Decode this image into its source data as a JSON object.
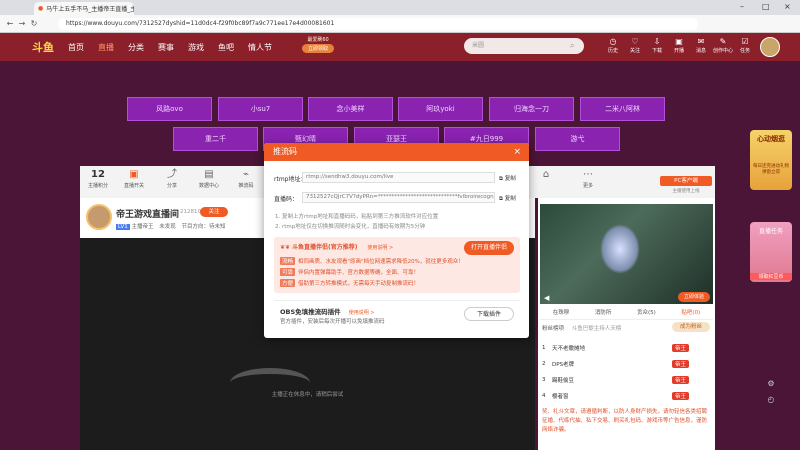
{
  "browser": {
    "tab_title": "马牛上五手不马_主播帝王直播_主",
    "url": "https://www.douyu.com/7312527dyshid=11d0dc4-f29f0bc89f7a9c771ee17e4d00081601"
  },
  "header": {
    "logo": "斗鱼",
    "nav": [
      "首页",
      "直播",
      "分类",
      "赛事",
      "游戏",
      "鱼吧",
      "情人节"
    ],
    "badge_top": "最爱刷60",
    "badge_bottom": "立即领取",
    "search_placeholder": "米圆",
    "icons": [
      {
        "name": "history-icon",
        "label": "历史"
      },
      {
        "name": "follow-icon",
        "label": "关注"
      },
      {
        "name": "download-icon",
        "label": "下载"
      },
      {
        "name": "broadcast-icon",
        "label": "开播"
      },
      {
        "name": "message-icon",
        "label": "消息"
      },
      {
        "name": "creator-icon",
        "label": "创作中心"
      },
      {
        "name": "task-icon",
        "label": "任务"
      }
    ]
  },
  "categories": {
    "row1": [
      "风路ovo",
      "小su7",
      "念小美样",
      "阿玖yoki",
      "归海念一刀",
      "二米八阿林"
    ],
    "row2": [
      "重二千",
      "甄幻晴",
      "亚瑟王",
      "#九日999",
      "游弋"
    ]
  },
  "toolbar": {
    "count": "12",
    "count_label": "主播积分",
    "items": [
      "直播开关",
      "分享",
      "数据中心",
      "推流码"
    ],
    "more": "更多",
    "pc_client": "PC客户端",
    "pc_client_sub": "主播使用上线"
  },
  "streamer": {
    "title": "帝王游戏直播间",
    "room_id": "212810",
    "follow": "关注",
    "level": "LV1",
    "sub": "主播帝王",
    "host": "未发现",
    "rank_label": "节目方向：",
    "rank_value": "待未知"
  },
  "video": {
    "status": "主播正在休息中，请稍后尝试"
  },
  "rightcol": {
    "open_btn": "立即体验",
    "tabs": [
      "在珠穆",
      "消防所",
      "贡众(5)",
      "贴吧(0)"
    ],
    "fans_label": "粉丝榜项",
    "fans_rank": "斗鱼巴黎主持人天榜",
    "join_btn": "成为粉丝",
    "ranks": [
      {
        "n": "1",
        "name": "天不老撒摊地",
        "badge": "帝王"
      },
      {
        "n": "2",
        "name": "DPS老牌",
        "badge": "帝王"
      },
      {
        "n": "3",
        "name": "踢鞋偷豆",
        "badge": "帝王"
      },
      {
        "n": "4",
        "name": "樱者窗",
        "badge": "帝王"
      }
    ],
    "notice": "奖、礼斗文章，请遵循判断，以防人身财产损失，请勿轻信各类招聘征婚、代练代抽、私下交易、刷买礼包码、游戏币等广告信息，谨防网络诈骗。"
  },
  "side": {
    "label1": "心动烟逛",
    "sub1": "每日还完进动礼物弹窗立得",
    "label2": "直播任务",
    "label3": "领取红豆币"
  },
  "modal": {
    "title": "推流码",
    "rtmp_label": "rtmp地址：",
    "rtmp_value": "rtmp://sendhw3.douyu.com/live",
    "code_label": "直播码：",
    "code_value": "7312527cQJrC7V?dyPRn=*****************************fvlbroirecognition=0",
    "copy": "复制",
    "notes": [
      "1. 复制上方rtmp地址和直播码码，粘贴到第三方推流软件对应位置",
      "2. rtmp地址仅在切换推流随时会变化，直播码有效期为5分钟"
    ],
    "promo_title": "斗鱼直播伴侣(官方推荐)",
    "promo_link": "使用说明 >",
    "promo_btn": "打开直播伴侣",
    "promo_lines": [
      {
        "tag": "流畅",
        "text": "相同画质、水友观看\"原画\"档位网速需求降低20%，就往更多观众！"
      },
      {
        "tag": "可靠",
        "text": "伴侣内置弹幕助手、官方数据等确，全面、可靠！"
      },
      {
        "tag": "方便",
        "text": "借助第三方转推模式，无需每天手动复制推流码！"
      }
    ],
    "obs_title": "OBS免填推流码插件",
    "obs_link": "使用说明 >",
    "obs_desc": "官方插件，安装后每次开播可以免填推流码",
    "obs_btn": "下载插件"
  }
}
